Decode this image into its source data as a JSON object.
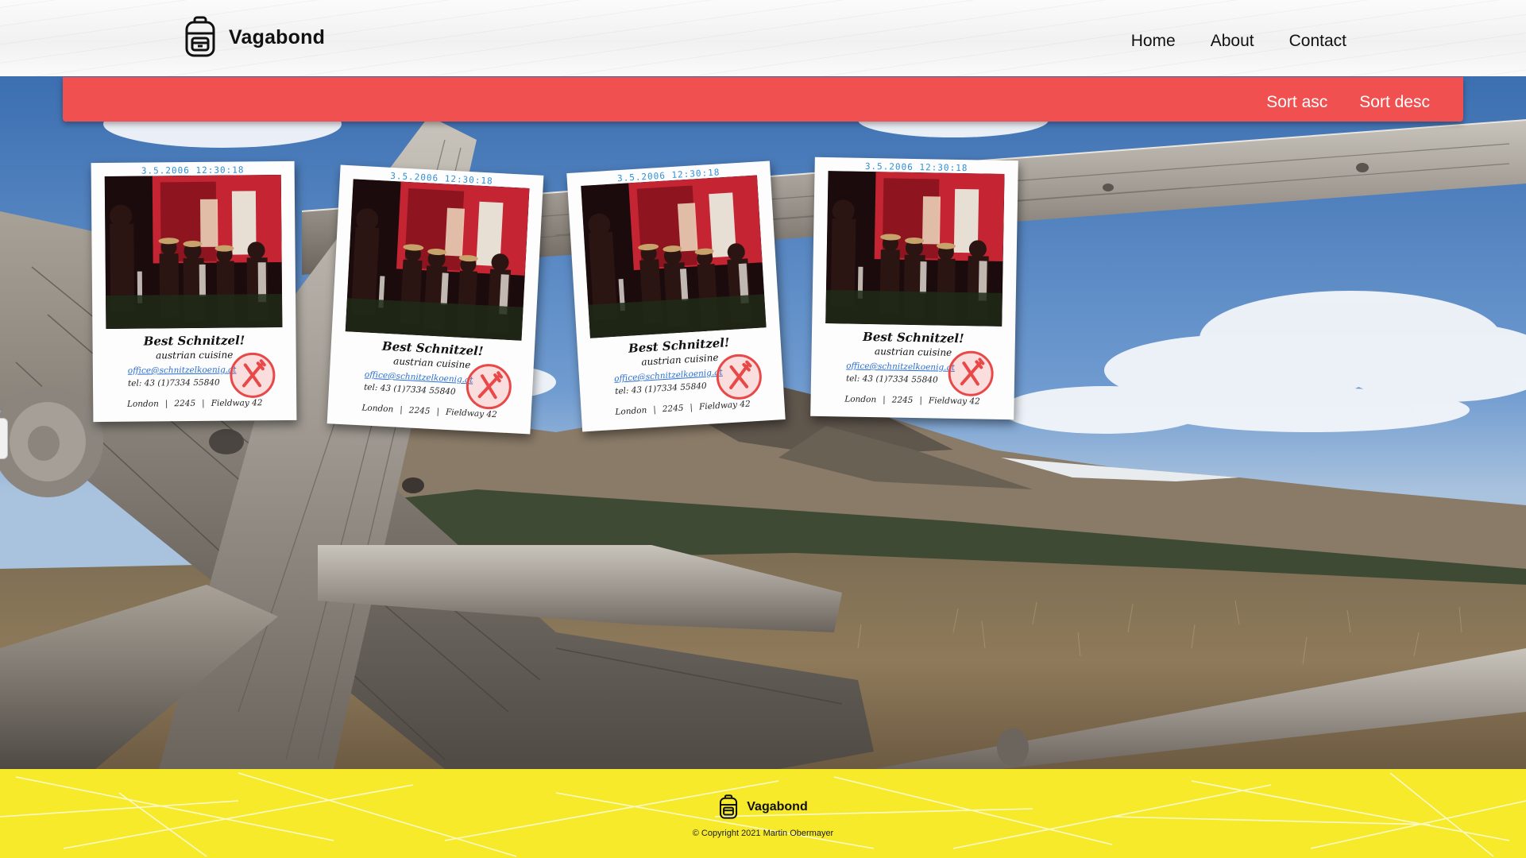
{
  "header": {
    "brand_name": "Vagabond",
    "brand_icon": "backpack-icon",
    "nav": [
      "Home",
      "About",
      "Contact"
    ]
  },
  "sortbar": {
    "sort_asc_label": "Sort asc",
    "sort_desc_label": "Sort desc",
    "color": "#f15050"
  },
  "cards": [
    {
      "date": "3.5.2006 12:30:18",
      "title": "Best Schnitzel!",
      "subtitle": "austrian cuisine",
      "email": "office@schnitzelkoenig.at",
      "tel": "tel: 43 (1)7334 55840",
      "address": [
        "London",
        "2245",
        "Fieldway 42"
      ],
      "badge_icon": "fork-knife-icon"
    },
    {
      "date": "3.5.2006 12:30:18",
      "title": "Best Schnitzel!",
      "subtitle": "austrian cuisine",
      "email": "office@schnitzelkoenig.at",
      "tel": "tel: 43 (1)7334 55840",
      "address": [
        "London",
        "2245",
        "Fieldway 42"
      ],
      "badge_icon": "fork-knife-icon"
    },
    {
      "date": "3.5.2006 12:30:18",
      "title": "Best Schnitzel!",
      "subtitle": "austrian cuisine",
      "email": "office@schnitzelkoenig.at",
      "tel": "tel: 43 (1)7334 55840",
      "address": [
        "London",
        "2245",
        "Fieldway 42"
      ],
      "badge_icon": "fork-knife-icon"
    },
    {
      "date": "3.5.2006 12:30:18",
      "title": "Best Schnitzel!",
      "subtitle": "austrian cuisine",
      "email": "office@schnitzelkoenig.at",
      "tel": "tel: 43 (1)7334 55840",
      "address": [
        "London",
        "2245",
        "Fieldway 42"
      ],
      "badge_icon": "fork-knife-icon"
    }
  ],
  "footer": {
    "brand_name": "Vagabond",
    "copyright": "© Copyright 2021 Martin Obermayer",
    "color": "#f6ea2a"
  }
}
